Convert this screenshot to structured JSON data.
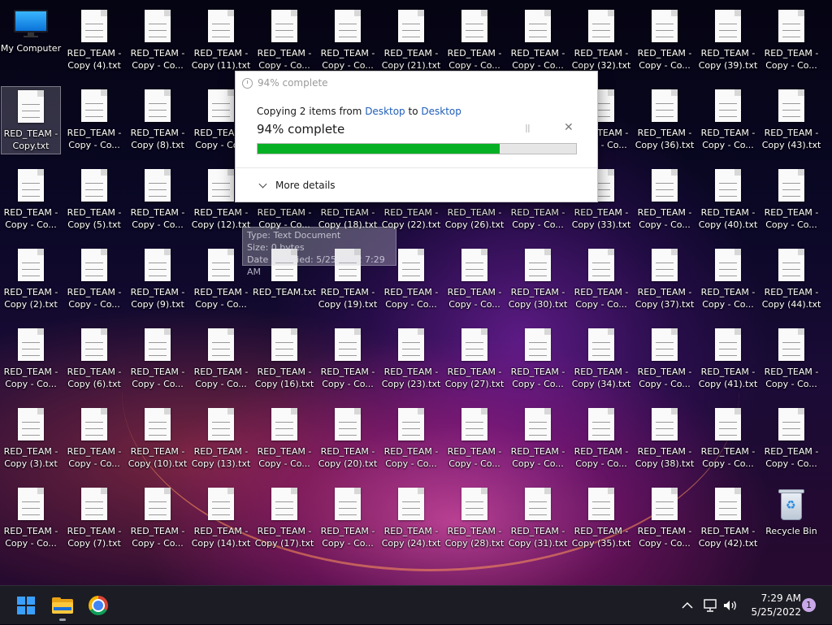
{
  "desktop": {
    "icons": [
      {
        "col": 0,
        "row": 0,
        "kind": "computer",
        "label": "My Computer",
        "selected": false
      },
      {
        "col": 1,
        "row": 0,
        "kind": "doc",
        "label": "RED_TEAM - Copy (4).txt"
      },
      {
        "col": 2,
        "row": 0,
        "kind": "doc",
        "label": "RED_TEAM - Copy - Co..."
      },
      {
        "col": 3,
        "row": 0,
        "kind": "doc",
        "label": "RED_TEAM - Copy (11).txt"
      },
      {
        "col": 4,
        "row": 0,
        "kind": "doc",
        "label": "RED_TEAM - Copy - Co..."
      },
      {
        "col": 5,
        "row": 0,
        "kind": "doc",
        "label": "RED_TEAM - Copy - Co..."
      },
      {
        "col": 6,
        "row": 0,
        "kind": "doc",
        "label": "RED_TEAM - Copy (21).txt"
      },
      {
        "col": 7,
        "row": 0,
        "kind": "doc",
        "label": "RED_TEAM - Copy - Co..."
      },
      {
        "col": 8,
        "row": 0,
        "kind": "doc",
        "label": "RED_TEAM - Copy - Co..."
      },
      {
        "col": 9,
        "row": 0,
        "kind": "doc",
        "label": "RED_TEAM - Copy (32).txt"
      },
      {
        "col": 10,
        "row": 0,
        "kind": "doc",
        "label": "RED_TEAM - Copy - Co..."
      },
      {
        "col": 11,
        "row": 0,
        "kind": "doc",
        "label": "RED_TEAM - Copy (39).txt"
      },
      {
        "col": 12,
        "row": 0,
        "kind": "doc",
        "label": "RED_TEAM - Copy - Co..."
      },
      {
        "col": 0,
        "row": 1,
        "kind": "doc",
        "label": "RED_TEAM - Copy.txt",
        "selected": true
      },
      {
        "col": 1,
        "row": 1,
        "kind": "doc",
        "label": "RED_TEAM - Copy - Co..."
      },
      {
        "col": 2,
        "row": 1,
        "kind": "doc",
        "label": "RED_TEAM - Copy (8).txt"
      },
      {
        "col": 3,
        "row": 1,
        "kind": "doc",
        "label": "RED_TEAM - Copy - Co..."
      },
      {
        "col": 9,
        "row": 1,
        "kind": "doc",
        "label": "RED_TEAM - Copy - Co..."
      },
      {
        "col": 10,
        "row": 1,
        "kind": "doc",
        "label": "RED_TEAM - Copy (36).txt"
      },
      {
        "col": 11,
        "row": 1,
        "kind": "doc",
        "label": "RED_TEAM - Copy - Co..."
      },
      {
        "col": 12,
        "row": 1,
        "kind": "doc",
        "label": "RED_TEAM - Copy (43).txt"
      },
      {
        "col": 0,
        "row": 2,
        "kind": "doc",
        "label": "RED_TEAM - Copy - Co..."
      },
      {
        "col": 1,
        "row": 2,
        "kind": "doc",
        "label": "RED_TEAM - Copy (5).txt"
      },
      {
        "col": 2,
        "row": 2,
        "kind": "doc",
        "label": "RED_TEAM - Copy - Co..."
      },
      {
        "col": 3,
        "row": 2,
        "kind": "doc",
        "label": "RED_TEAM - Copy (12).txt"
      },
      {
        "col": 4,
        "row": 2,
        "kind": "doc",
        "label": "RED_TEAM - Copy - Co..."
      },
      {
        "col": 5,
        "row": 2,
        "kind": "doc",
        "label": "RED_TEAM - Copy (18).txt"
      },
      {
        "col": 6,
        "row": 2,
        "kind": "doc",
        "label": "RED_TEAM - Copy (22).txt"
      },
      {
        "col": 7,
        "row": 2,
        "kind": "doc",
        "label": "RED_TEAM - Copy (26).txt"
      },
      {
        "col": 8,
        "row": 2,
        "kind": "doc",
        "label": "RED_TEAM - Copy - Co..."
      },
      {
        "col": 9,
        "row": 2,
        "kind": "doc",
        "label": "RED_TEAM - Copy (33).txt"
      },
      {
        "col": 10,
        "row": 2,
        "kind": "doc",
        "label": "RED_TEAM - Copy - Co..."
      },
      {
        "col": 11,
        "row": 2,
        "kind": "doc",
        "label": "RED_TEAM - Copy (40).txt"
      },
      {
        "col": 12,
        "row": 2,
        "kind": "doc",
        "label": "RED_TEAM - Copy - Co..."
      },
      {
        "col": 0,
        "row": 3,
        "kind": "doc",
        "label": "RED_TEAM - Copy (2).txt"
      },
      {
        "col": 1,
        "row": 3,
        "kind": "doc",
        "label": "RED_TEAM - Copy - Co..."
      },
      {
        "col": 2,
        "row": 3,
        "kind": "doc",
        "label": "RED_TEAM - Copy (9).txt"
      },
      {
        "col": 3,
        "row": 3,
        "kind": "doc",
        "label": "RED_TEAM - Copy - Co..."
      },
      {
        "col": 4,
        "row": 3,
        "kind": "doc",
        "label": "RED_TEAM.txt"
      },
      {
        "col": 5,
        "row": 3,
        "kind": "doc",
        "label": "RED_TEAM - Copy (19).txt"
      },
      {
        "col": 6,
        "row": 3,
        "kind": "doc",
        "label": "RED_TEAM - Copy - Co..."
      },
      {
        "col": 7,
        "row": 3,
        "kind": "doc",
        "label": "RED_TEAM - Copy - Co..."
      },
      {
        "col": 8,
        "row": 3,
        "kind": "doc",
        "label": "RED_TEAM - Copy (30).txt"
      },
      {
        "col": 9,
        "row": 3,
        "kind": "doc",
        "label": "RED_TEAM - Copy - Co..."
      },
      {
        "col": 10,
        "row": 3,
        "kind": "doc",
        "label": "RED_TEAM - Copy (37).txt"
      },
      {
        "col": 11,
        "row": 3,
        "kind": "doc",
        "label": "RED_TEAM - Copy - Co..."
      },
      {
        "col": 12,
        "row": 3,
        "kind": "doc",
        "label": "RED_TEAM - Copy (44).txt"
      },
      {
        "col": 0,
        "row": 4,
        "kind": "doc",
        "label": "RED_TEAM - Copy - Co..."
      },
      {
        "col": 1,
        "row": 4,
        "kind": "doc",
        "label": "RED_TEAM - Copy (6).txt"
      },
      {
        "col": 2,
        "row": 4,
        "kind": "doc",
        "label": "RED_TEAM - Copy - Co..."
      },
      {
        "col": 3,
        "row": 4,
        "kind": "doc",
        "label": "RED_TEAM - Copy - Co..."
      },
      {
        "col": 4,
        "row": 4,
        "kind": "doc",
        "label": "RED_TEAM - Copy (16).txt"
      },
      {
        "col": 5,
        "row": 4,
        "kind": "doc",
        "label": "RED_TEAM - Copy - Co..."
      },
      {
        "col": 6,
        "row": 4,
        "kind": "doc",
        "label": "RED_TEAM - Copy (23).txt"
      },
      {
        "col": 7,
        "row": 4,
        "kind": "doc",
        "label": "RED_TEAM - Copy (27).txt"
      },
      {
        "col": 8,
        "row": 4,
        "kind": "doc",
        "label": "RED_TEAM - Copy - Co..."
      },
      {
        "col": 9,
        "row": 4,
        "kind": "doc",
        "label": "RED_TEAM - Copy (34).txt"
      },
      {
        "col": 10,
        "row": 4,
        "kind": "doc",
        "label": "RED_TEAM - Copy - Co..."
      },
      {
        "col": 11,
        "row": 4,
        "kind": "doc",
        "label": "RED_TEAM - Copy (41).txt"
      },
      {
        "col": 12,
        "row": 4,
        "kind": "doc",
        "label": "RED_TEAM - Copy - Co..."
      },
      {
        "col": 0,
        "row": 5,
        "kind": "doc",
        "label": "RED_TEAM - Copy (3).txt"
      },
      {
        "col": 1,
        "row": 5,
        "kind": "doc",
        "label": "RED_TEAM - Copy - Co..."
      },
      {
        "col": 2,
        "row": 5,
        "kind": "doc",
        "label": "RED_TEAM - Copy (10).txt"
      },
      {
        "col": 3,
        "row": 5,
        "kind": "doc",
        "label": "RED_TEAM - Copy (13).txt"
      },
      {
        "col": 4,
        "row": 5,
        "kind": "doc",
        "label": "RED_TEAM - Copy - Co..."
      },
      {
        "col": 5,
        "row": 5,
        "kind": "doc",
        "label": "RED_TEAM - Copy (20).txt"
      },
      {
        "col": 6,
        "row": 5,
        "kind": "doc",
        "label": "RED_TEAM - Copy - Co..."
      },
      {
        "col": 7,
        "row": 5,
        "kind": "doc",
        "label": "RED_TEAM - Copy - Co..."
      },
      {
        "col": 8,
        "row": 5,
        "kind": "doc",
        "label": "RED_TEAM - Copy - Co..."
      },
      {
        "col": 9,
        "row": 5,
        "kind": "doc",
        "label": "RED_TEAM - Copy - Co..."
      },
      {
        "col": 10,
        "row": 5,
        "kind": "doc",
        "label": "RED_TEAM - Copy (38).txt"
      },
      {
        "col": 11,
        "row": 5,
        "kind": "doc",
        "label": "RED_TEAM - Copy - Co..."
      },
      {
        "col": 12,
        "row": 5,
        "kind": "doc",
        "label": "RED_TEAM - Copy - Co..."
      },
      {
        "col": 0,
        "row": 6,
        "kind": "doc",
        "label": "RED_TEAM - Copy - Co..."
      },
      {
        "col": 1,
        "row": 6,
        "kind": "doc",
        "label": "RED_TEAM - Copy (7).txt"
      },
      {
        "col": 2,
        "row": 6,
        "kind": "doc",
        "label": "RED_TEAM - Copy - Co..."
      },
      {
        "col": 3,
        "row": 6,
        "kind": "doc",
        "label": "RED_TEAM - Copy (14).txt"
      },
      {
        "col": 4,
        "row": 6,
        "kind": "doc",
        "label": "RED_TEAM - Copy (17).txt"
      },
      {
        "col": 5,
        "row": 6,
        "kind": "doc",
        "label": "RED_TEAM - Copy - Co..."
      },
      {
        "col": 6,
        "row": 6,
        "kind": "doc",
        "label": "RED_TEAM - Copy (24).txt"
      },
      {
        "col": 7,
        "row": 6,
        "kind": "doc",
        "label": "RED_TEAM - Copy (28).txt"
      },
      {
        "col": 8,
        "row": 6,
        "kind": "doc",
        "label": "RED_TEAM - Copy (31).txt"
      },
      {
        "col": 9,
        "row": 6,
        "kind": "doc",
        "label": "RED_TEAM - Copy (35).txt"
      },
      {
        "col": 10,
        "row": 6,
        "kind": "doc",
        "label": "RED_TEAM - Copy - Co..."
      },
      {
        "col": 11,
        "row": 6,
        "kind": "doc",
        "label": "RED_TEAM - Copy (42).txt"
      },
      {
        "col": 12,
        "row": 6,
        "kind": "bin",
        "label": "Recycle Bin"
      }
    ]
  },
  "tooltip": {
    "type": "Type: Text Document",
    "size": "Size: 0 bytes",
    "modified": "Date modified: 5/25/2022 7:29 AM"
  },
  "dialog": {
    "title": "94% complete",
    "copying_prefix": "Copying 2 items from ",
    "source": "Desktop",
    "copying_mid": " to ",
    "destination": "Desktop",
    "percent_label": "94% complete",
    "progress": 0.76,
    "pause_glyph": "II",
    "close_glyph": "✕",
    "more_details": "More details",
    "colors": {
      "progress": "#06b025",
      "link": "#1f5eb8"
    }
  },
  "taskbar": {
    "items": [
      {
        "name": "start-button",
        "icon": "windows-logo-icon"
      },
      {
        "name": "file-explorer-button",
        "icon": "folder-icon",
        "running": true
      },
      {
        "name": "chrome-button",
        "icon": "chrome-icon"
      }
    ],
    "tray": {
      "chevron": "^",
      "network_icon": "network-icon",
      "volume_icon": "volume-icon",
      "time": "7:29 AM",
      "date": "5/25/2022",
      "notifications": "1"
    }
  }
}
